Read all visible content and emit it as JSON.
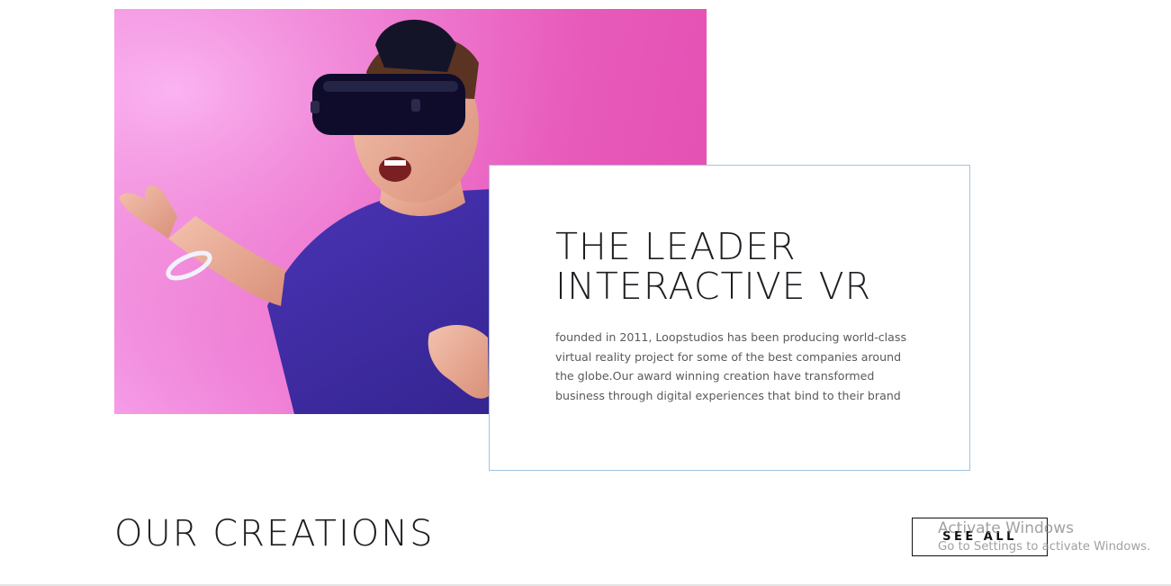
{
  "intro": {
    "title": "THE LEADER\nINTERACTIVE VR",
    "text": "founded in 2011, Loopstudios has been producing world-class virtual reality project for some of the best companies around the globe.Our award winning creation have transformed business through digital experiences that bind to their brand"
  },
  "creations": {
    "title": "OUR CREATIONS",
    "see_all_label": "SEE ALL"
  },
  "watermark": {
    "title": "Activate Windows",
    "subtitle": "Go to Settings to activate Windows."
  },
  "colors": {
    "card_border": "#9cc4e4",
    "text_dark": "#1d1d22",
    "photo_background": "#e85bbb",
    "shirt": "#3e2c9c"
  }
}
